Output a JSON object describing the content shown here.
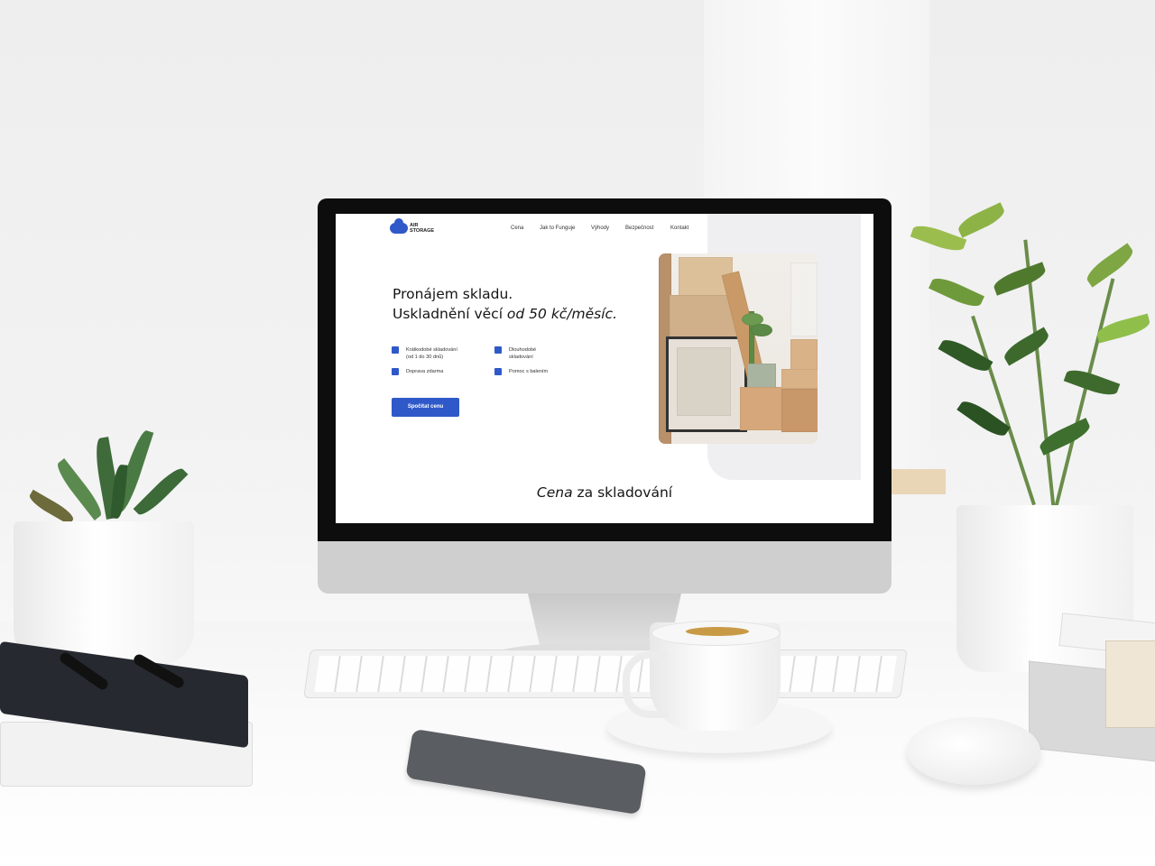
{
  "site": {
    "logo": {
      "line1": "AIR",
      "line2": "STORAGE"
    },
    "nav": [
      "Cena",
      "Jak to Funguje",
      "Výhody",
      "Bezpečnost",
      "Kontakt"
    ],
    "hero": {
      "title_line1": "Pronájem skladu.",
      "title_line2_plain": "Uskladnění věcí ",
      "title_line2_italic": "od 50 kč/měsíc."
    },
    "features": [
      {
        "line1": "Krátkodobé skladování",
        "line2": "(od 1 do 30 dnů)"
      },
      {
        "line1": "Dlouhodobé",
        "line2": "skladování"
      },
      {
        "line1": "Doprava zdarma",
        "line2": ""
      },
      {
        "line1": "Pomoc s balením",
        "line2": ""
      }
    ],
    "cta_label": "Spočítat cenu",
    "section_title_italic": "Cena",
    "section_title_rest": " za skladování"
  },
  "colors": {
    "accent": "#2f59c9",
    "text": "#151515",
    "screen_bg": "#ffffff"
  },
  "scene": {
    "icons": [
      "cloud-logo-icon",
      "checkbox-bullet-icon"
    ]
  }
}
